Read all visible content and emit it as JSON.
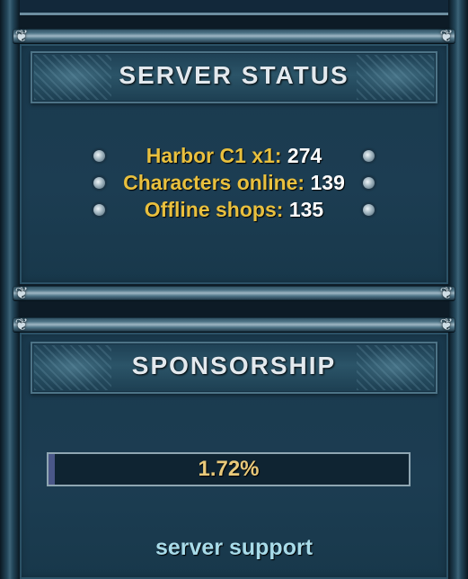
{
  "server_status": {
    "title": "SERVER STATUS",
    "stats": [
      {
        "label": "Harbor C1 x1:",
        "value": "274"
      },
      {
        "label": "Characters online:",
        "value": "139"
      },
      {
        "label": "Offline shops:",
        "value": "135"
      }
    ]
  },
  "sponsorship": {
    "title": "SPONSORSHIP",
    "progress_text": "1.72%",
    "progress_fraction": 0.0172,
    "link_label": "server support"
  },
  "colors": {
    "label": "#e9c03e",
    "value": "#ffffff",
    "link": "#a8dbe9",
    "progress_text": "#e9c97a"
  },
  "icons": {
    "bullet": "bullet-dot-icon",
    "bar_end": "scroll-ornament-icon"
  }
}
